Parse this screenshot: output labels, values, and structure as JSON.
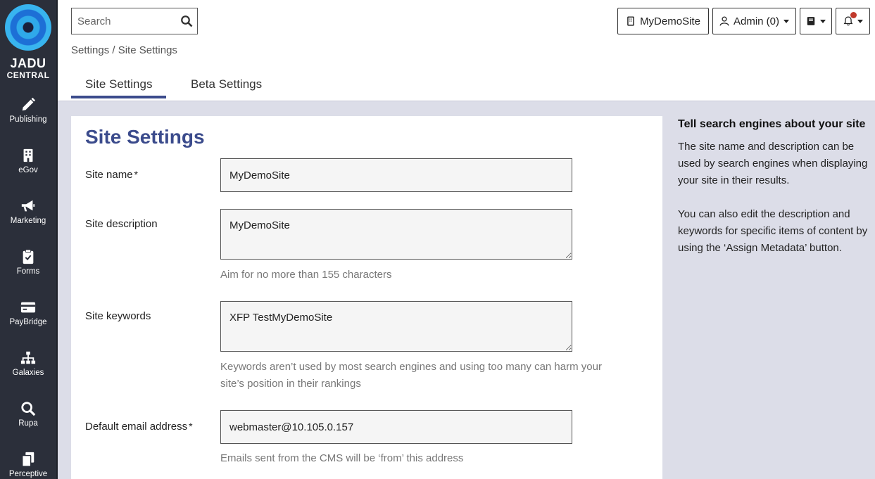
{
  "brand": {
    "line1": "JADU",
    "line2": "CENTRAL"
  },
  "sidebar": {
    "items": [
      {
        "label": "Publishing",
        "icon": "pencil-icon"
      },
      {
        "label": "eGov",
        "icon": "building-icon"
      },
      {
        "label": "Marketing",
        "icon": "megaphone-icon"
      },
      {
        "label": "Forms",
        "icon": "clipboard-check-icon"
      },
      {
        "label": "PayBridge",
        "icon": "credit-card-icon"
      },
      {
        "label": "Galaxies",
        "icon": "sitemap-icon"
      },
      {
        "label": "Rupa",
        "icon": "search-icon"
      },
      {
        "label": "Perceptive",
        "icon": "documents-icon"
      }
    ]
  },
  "search": {
    "placeholder": "Search"
  },
  "topbar": {
    "site_label": "MyDemoSite",
    "user_label": "Admin (0)"
  },
  "breadcrumb": "Settings / Site Settings",
  "tabs": [
    {
      "label": "Site Settings",
      "active": true
    },
    {
      "label": "Beta Settings",
      "active": false
    }
  ],
  "form": {
    "title": "Site Settings",
    "required_marker": "*",
    "site_name": {
      "label": "Site name",
      "value": "MyDemoSite"
    },
    "site_description": {
      "label": "Site description",
      "value": "MyDemoSite",
      "help": "Aim for no more than 155 characters"
    },
    "site_keywords": {
      "label": "Site keywords",
      "value": "XFP TestMyDemoSite",
      "help": "Keywords aren’t used by most search engines and using too many can harm your site’s position in their rankings"
    },
    "default_email": {
      "label": "Default email address",
      "value": "webmaster@10.105.0.157",
      "help": "Emails sent from the CMS will be ‘from’ this address"
    }
  },
  "help_panel": {
    "title": "Tell search engines about your site",
    "para1": "The site name and description can be used by search engines when displaying your site in their results.",
    "para2": "You can also edit the description and keywords for specific items of content by using the ‘Assign Metadata’ button."
  },
  "colors": {
    "sidebar_bg": "#2b2f3a",
    "accent": "#3b4b8c",
    "content_bg": "#dcdde8",
    "notification_dot": "#c0392b"
  }
}
